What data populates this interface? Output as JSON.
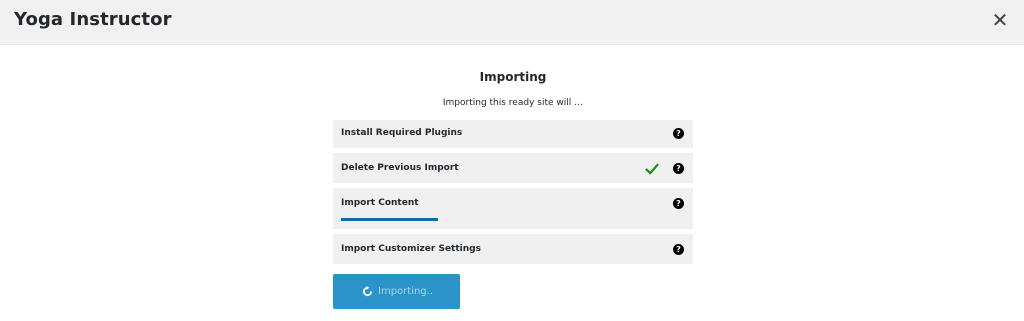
{
  "modal": {
    "title": "Yoga Instructor",
    "close_label": "✕"
  },
  "main": {
    "heading": "Importing",
    "subtitle": "Importing this ready site will …",
    "steps": [
      {
        "label": "Install Required Plugins",
        "status": "pending",
        "help_icon": "question-circle-icon"
      },
      {
        "label": "Delete Previous Import",
        "status": "done",
        "check_icon": "checkmark-icon",
        "help_icon": "question-circle-icon"
      },
      {
        "label": "Import Content",
        "status": "in-progress",
        "progress": 0.27,
        "help_icon": "question-circle-icon"
      },
      {
        "label": "Import Customizer Settings",
        "status": "pending",
        "help_icon": "question-circle-icon"
      }
    ],
    "help_glyph": "?",
    "button": {
      "label": "Importing..",
      "icon": "refresh-spinner-icon"
    }
  },
  "colors": {
    "header_bg": "#f1f1f1",
    "step_bg": "#f0f0f0",
    "progress": "#0b6ea8",
    "check": "#1a8c1a",
    "button_bg": "#2a93c9",
    "button_text": "#a9d8ef"
  }
}
